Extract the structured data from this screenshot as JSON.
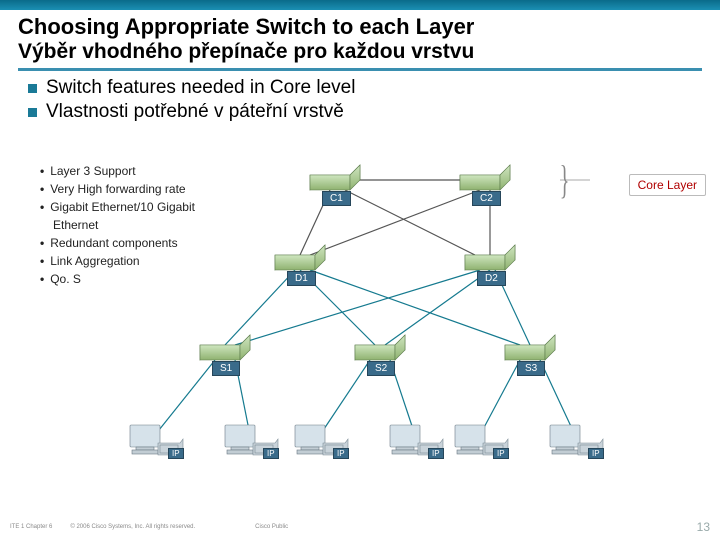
{
  "title": {
    "en": "Choosing Appropriate Switch to each Layer",
    "cs": "Výběr vhodného přepínače pro každou vrstvu"
  },
  "main_bullets": {
    "en": "Switch features needed in Core level",
    "cs": "Vlastnosti potřebné v páteřní vrstvě"
  },
  "features": {
    "b0": "Layer 3 Support",
    "b1": "Very High forwarding rate",
    "b2": "Gigabit Ethernet/10 Gigabit",
    "b2b": "Ethernet",
    "b3": "Redundant components",
    "b4": "Link Aggregation",
    "b5": "Qo. S"
  },
  "labels": {
    "c1": "C1",
    "c2": "C2",
    "d1": "D1",
    "d2": "D2",
    "s1": "S1",
    "s2": "S2",
    "s3": "S3",
    "ip": "IP"
  },
  "callouts": {
    "core": "Core Layer"
  },
  "footer": {
    "left": "ITE 1 Chapter 6",
    "center": "© 2006 Cisco Systems, Inc. All rights reserved.",
    "right": "Cisco Public",
    "page": "13"
  }
}
